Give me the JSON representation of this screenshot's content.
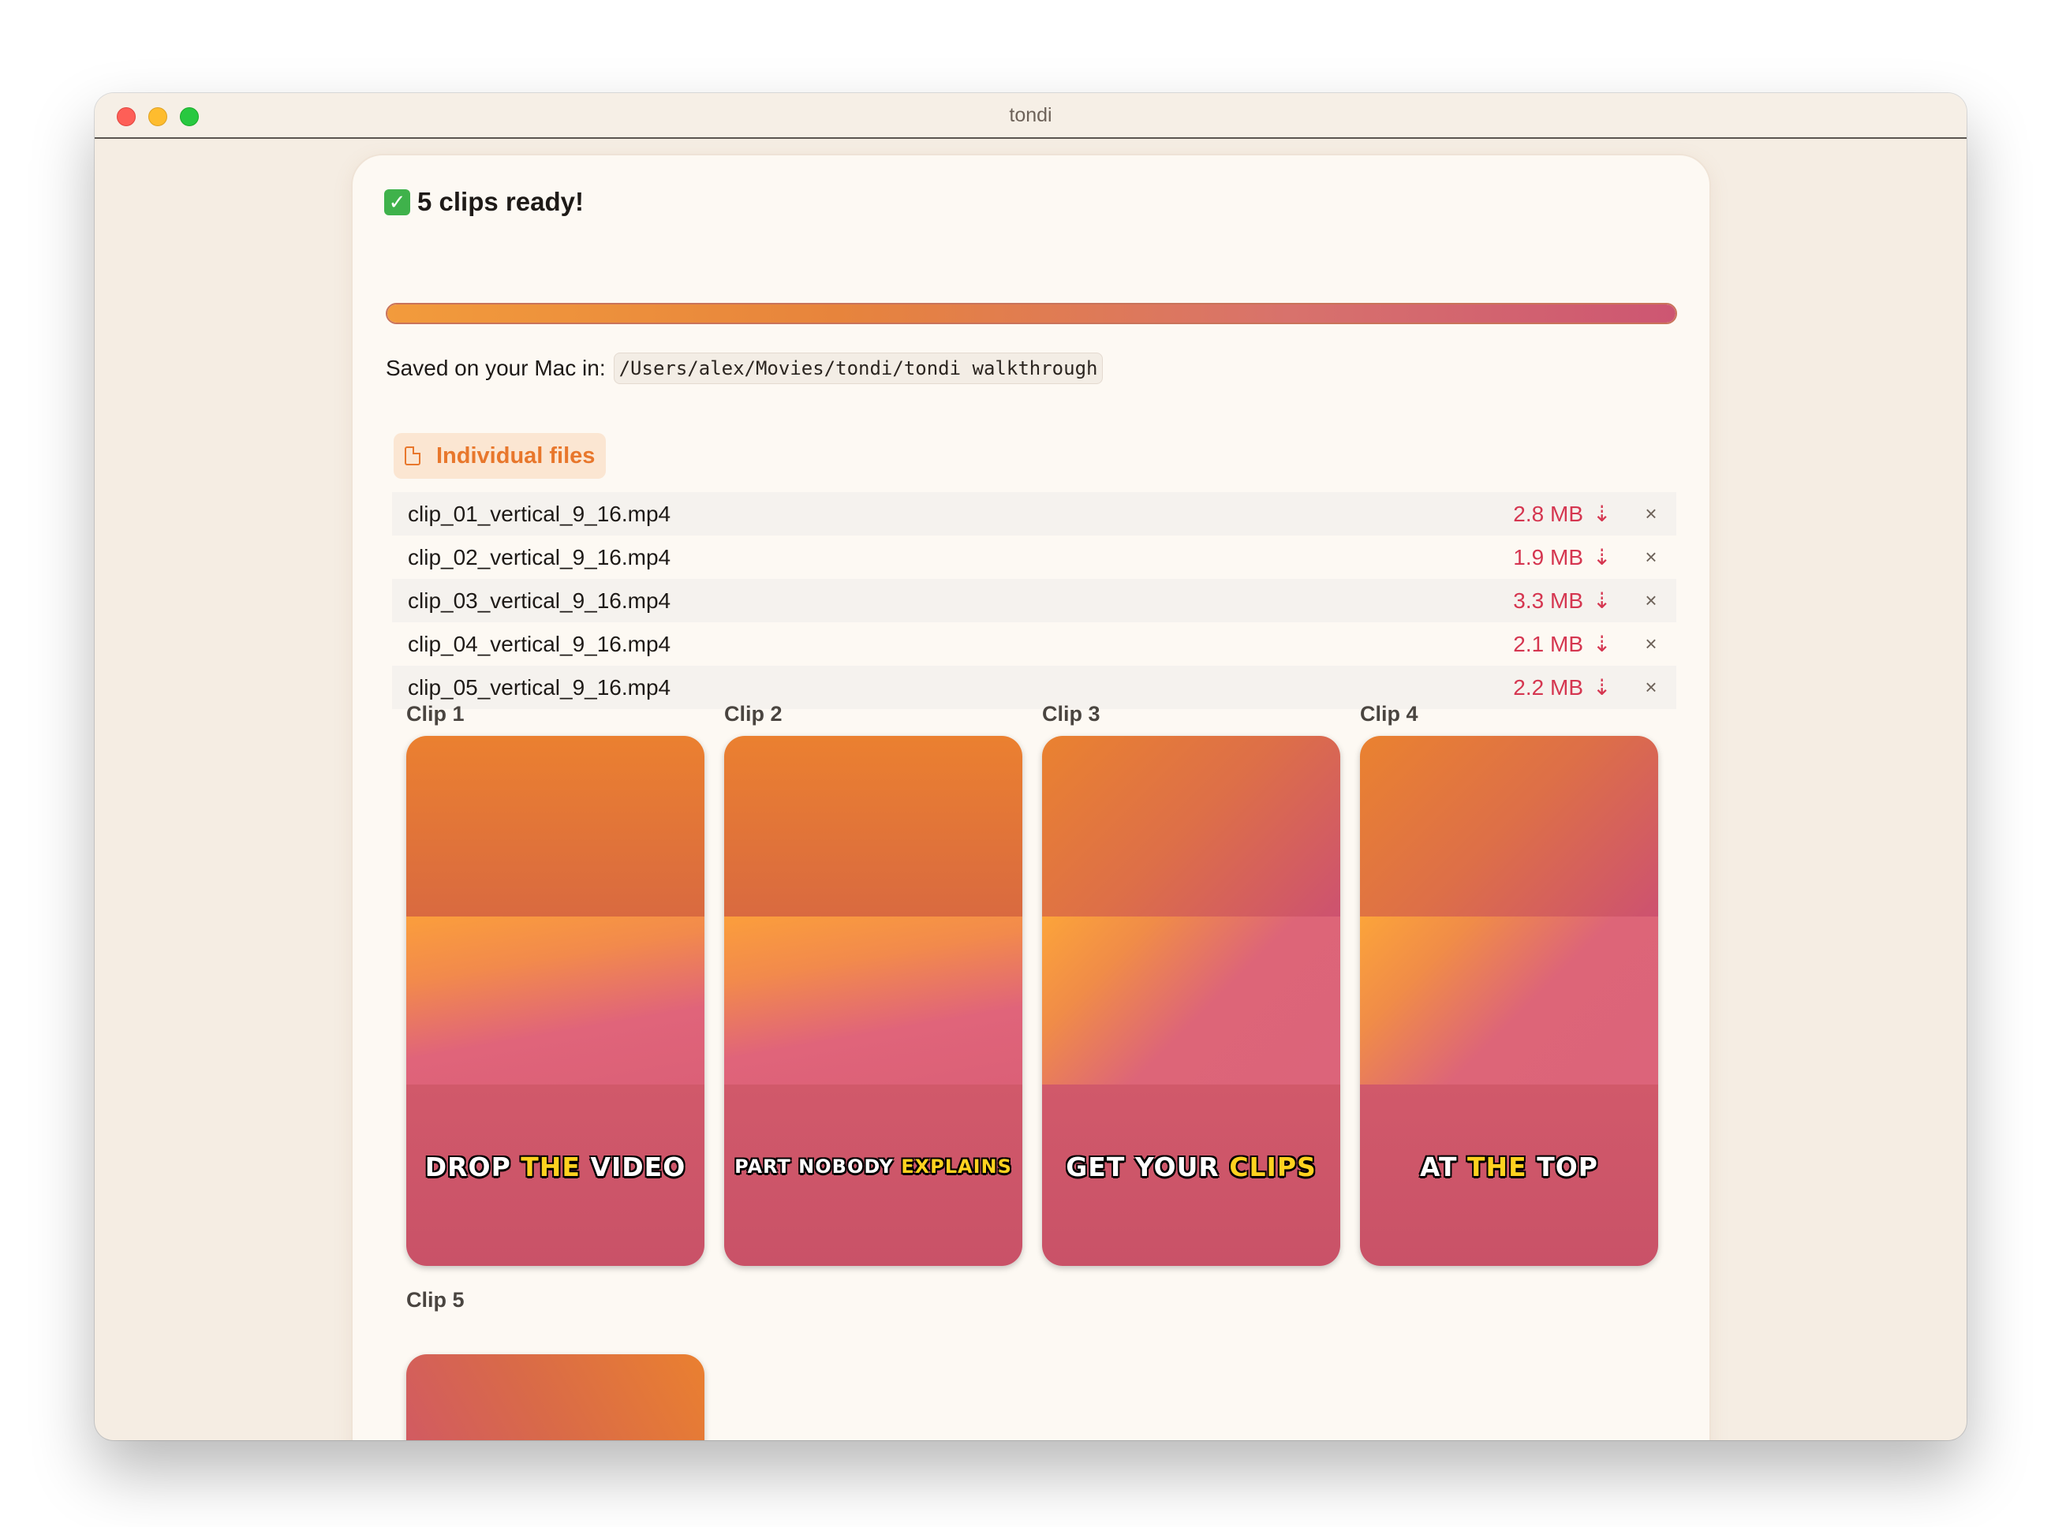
{
  "window": {
    "title": "tondi"
  },
  "status": {
    "check_icon": "✓",
    "heading": "5 clips ready!",
    "progress": 1.0
  },
  "saved": {
    "label": "Saved on your Mac in:",
    "path": "/Users/alex/Movies/tondi/tondi walkthrough"
  },
  "section": {
    "tab_label": "Individual files",
    "tab_icon": "file-icon"
  },
  "files": [
    {
      "name": "clip_01_vertical_9_16.mp4",
      "size": "2.8 MB"
    },
    {
      "name": "clip_02_vertical_9_16.mp4",
      "size": "1.9 MB"
    },
    {
      "name": "clip_03_vertical_9_16.mp4",
      "size": "3.3 MB"
    },
    {
      "name": "clip_04_vertical_9_16.mp4",
      "size": "2.1 MB"
    },
    {
      "name": "clip_05_vertical_9_16.mp4",
      "size": "2.2 MB"
    }
  ],
  "icons": {
    "download": "⇣",
    "remove": "×"
  },
  "clips": [
    {
      "label": "Clip 1",
      "caption": {
        "w1": "DROP",
        "hl": "THE",
        "w3": "VIDEO"
      }
    },
    {
      "label": "Clip 2",
      "caption": {
        "w1": "PART",
        "w2": "NOBODY",
        "hl": "EXPLAINS"
      }
    },
    {
      "label": "Clip 3",
      "caption": {
        "w1": "GET",
        "w2": "YOUR",
        "hl": "CLIPS"
      }
    },
    {
      "label": "Clip 4",
      "caption": {
        "w1": "AT",
        "hl": "THE",
        "w3": "TOP"
      }
    },
    {
      "label": "Clip 5"
    }
  ],
  "colors": {
    "accent_orange": "#e8772c",
    "size_red": "#d53650",
    "caption_highlight": "#ffd21f"
  }
}
